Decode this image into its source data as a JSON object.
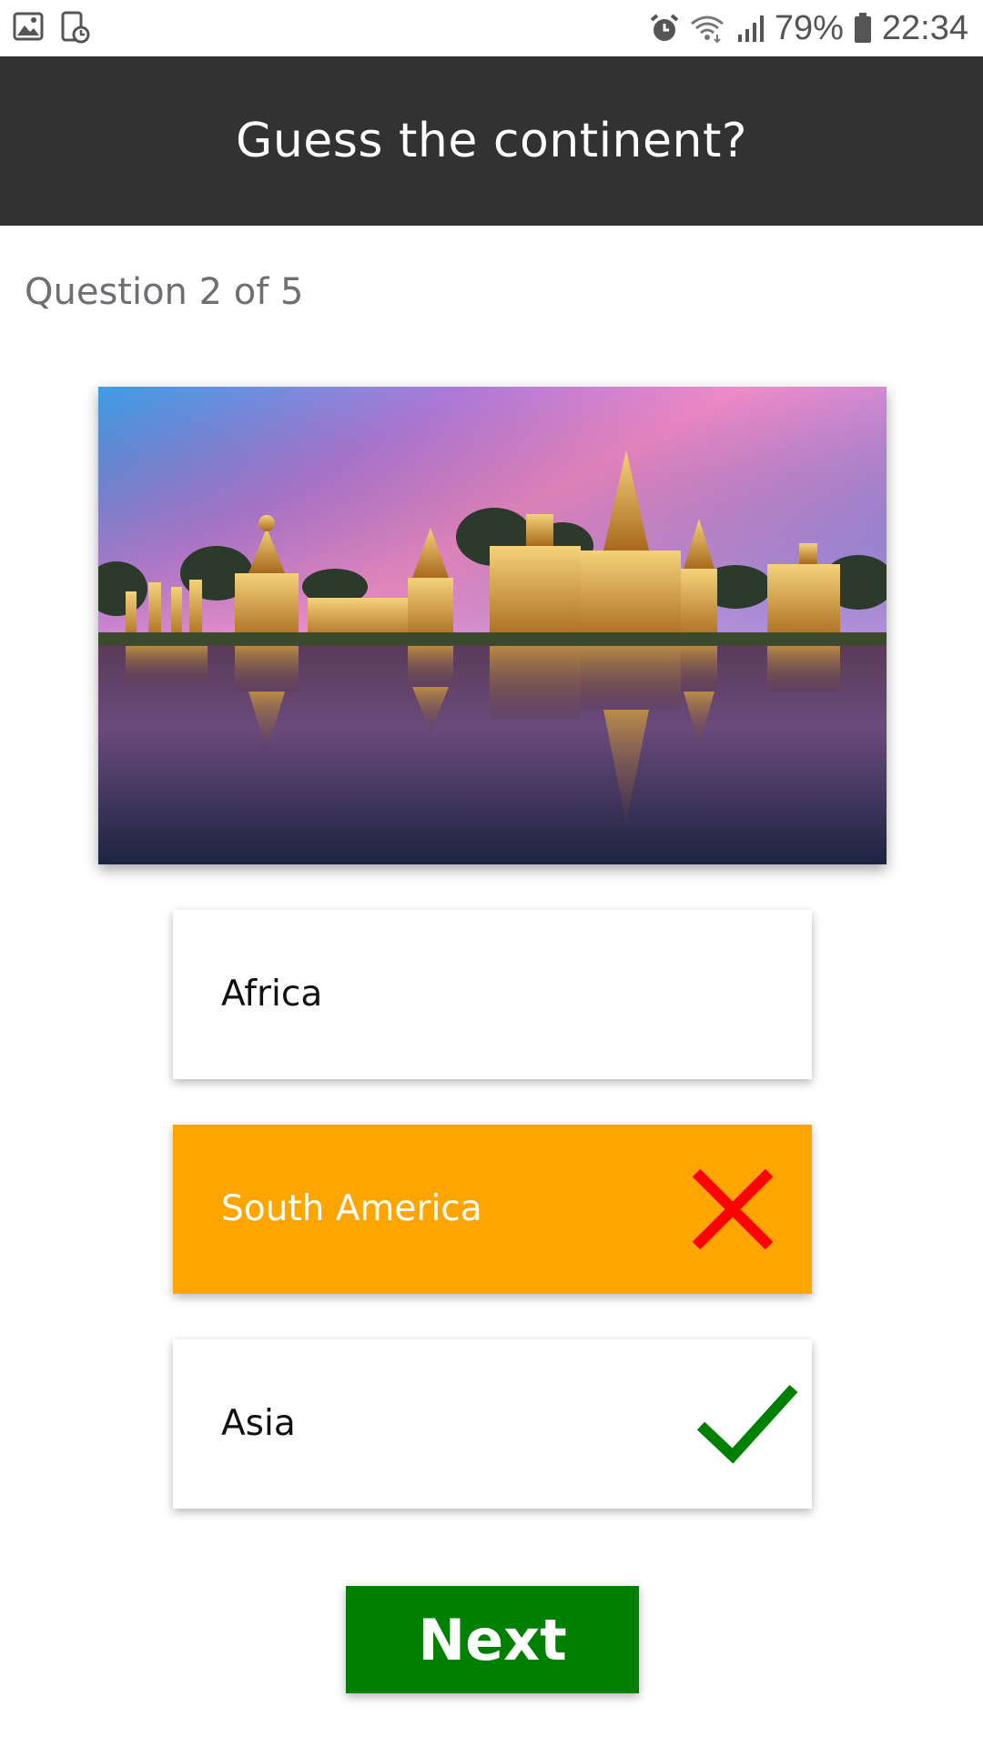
{
  "status_bar": {
    "battery_percent": "79%",
    "time": "22:34",
    "icons": [
      "gallery-icon",
      "screenshot-icon",
      "alarm-icon",
      "wifi-icon",
      "signal-icon",
      "battery-icon"
    ]
  },
  "header": {
    "title": "Guess the continent?"
  },
  "quiz": {
    "counter": "Question 2 of 5",
    "image_icon": "temple-photo",
    "options": [
      {
        "label": "Africa",
        "state": "neutral"
      },
      {
        "label": "South America",
        "state": "wrong",
        "icon": "cross-icon"
      },
      {
        "label": "Asia",
        "state": "correct",
        "icon": "check-icon"
      }
    ],
    "next_label": "Next"
  },
  "colors": {
    "header_bg": "#323232",
    "wrong_bg": "#ffa500",
    "cross": "#ff0000",
    "check": "#008000",
    "next_bg": "#008000"
  }
}
